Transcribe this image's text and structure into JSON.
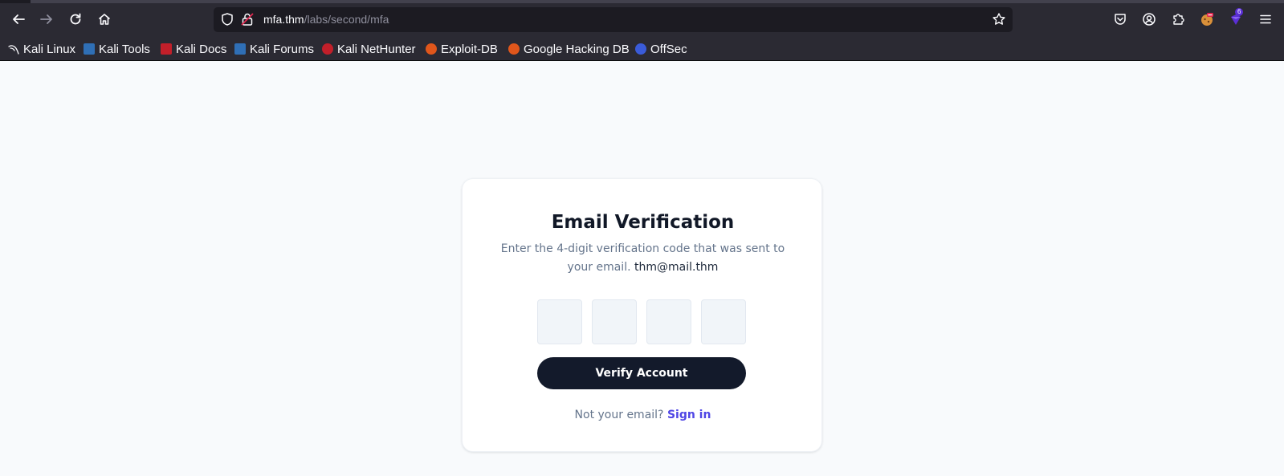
{
  "browser": {
    "url_host": "mfa.thm",
    "url_path": "/labs/second/mfa",
    "extension_badge": "6",
    "bookmarks": [
      {
        "label": "Kali Linux",
        "color": "#3a6ea5"
      },
      {
        "label": "Kali Tools",
        "color": "#2f6fb6"
      },
      {
        "label": "Kali Docs",
        "color": "#c21f2a"
      },
      {
        "label": "Kali Forums",
        "color": "#2f6fb6"
      },
      {
        "label": "Kali NetHunter",
        "color": "#c21f2a"
      },
      {
        "label": "Exploit-DB",
        "color": "#e0561b"
      },
      {
        "label": "Google Hacking DB",
        "color": "#e0561b"
      },
      {
        "label": "OffSec",
        "color": "#3a5bd9"
      }
    ]
  },
  "card": {
    "title": "Email Verification",
    "description": "Enter the 4-digit verification code that was sent to your email.",
    "email": "thm@mail.thm",
    "verify_label": "Verify Account",
    "footer_prefix": "Not your email?",
    "footer_link": "Sign in"
  },
  "colors": {
    "button_bg": "#131a2b",
    "link": "#4f46e5"
  }
}
